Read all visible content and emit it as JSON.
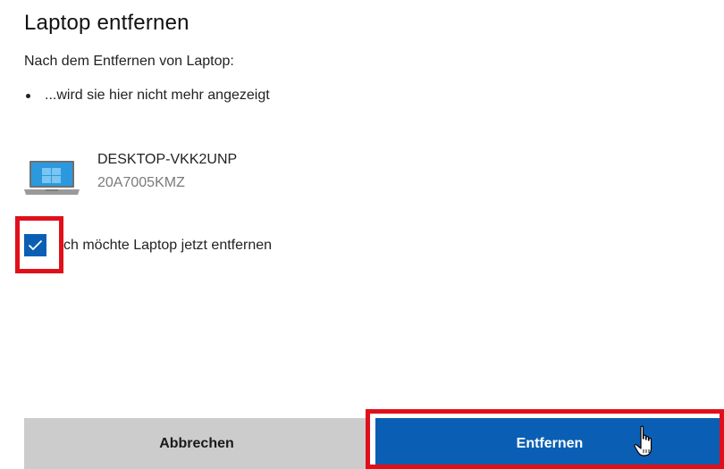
{
  "dialog": {
    "title": "Laptop entfernen",
    "subtitle": "Nach dem Entfernen von Laptop:",
    "bullet": "...wird sie hier nicht mehr angezeigt"
  },
  "device": {
    "icon": "laptop-icon",
    "name": "DESKTOP-VKK2UNP",
    "model": "20A7005KMZ"
  },
  "confirm": {
    "checked": true,
    "label": "ch möchte Laptop jetzt entfernen"
  },
  "buttons": {
    "cancel_label": "Abbrechen",
    "remove_label": "Entfernen"
  },
  "colors": {
    "accent": "#0a5fb4",
    "highlight": "#e0101a",
    "cancel_bg": "#cccccc"
  }
}
